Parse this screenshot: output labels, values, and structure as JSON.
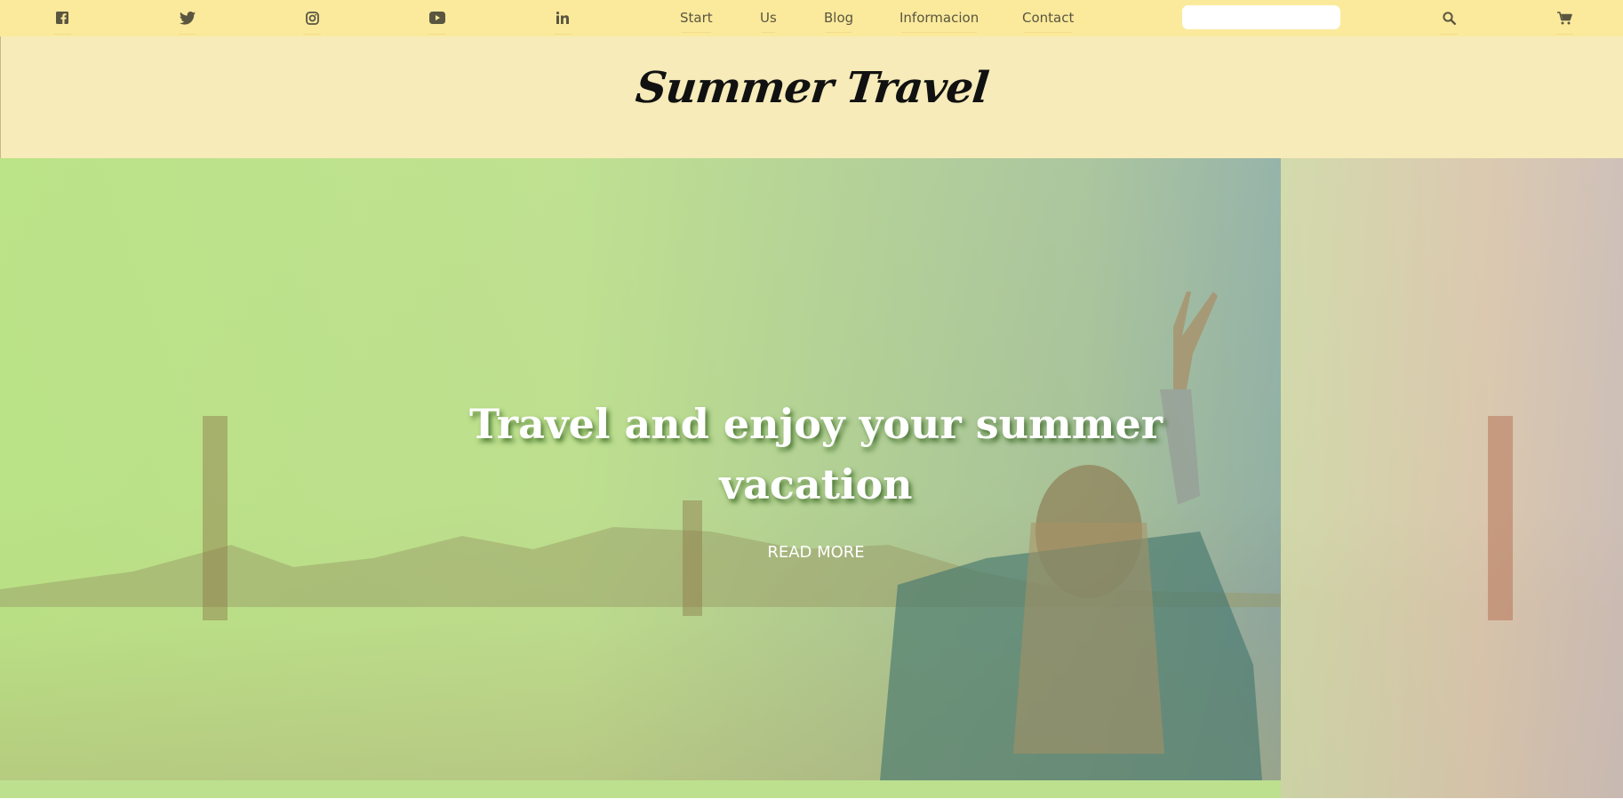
{
  "topbar": {
    "social_icons": [
      "facebook-icon",
      "twitter-icon",
      "instagram-icon",
      "youtube-icon",
      "linkedin-icon"
    ],
    "nav": {
      "start": "Start",
      "us": "Us",
      "blog": "Blog",
      "informacion": "Informacion",
      "contact": "Contact"
    },
    "search": {
      "value": "",
      "placeholder": ""
    },
    "tools": [
      "search-icon",
      "cart-icon"
    ]
  },
  "header": {
    "logo": "Summer Travel"
  },
  "hero": {
    "title": "Travel and enjoy your summer vacation",
    "cta": "READ MORE"
  },
  "colors": {
    "topbar": "#fbea9c",
    "header": "#f6ebb9",
    "hero_overlay": "#bde08f",
    "text": "#5a553f"
  }
}
